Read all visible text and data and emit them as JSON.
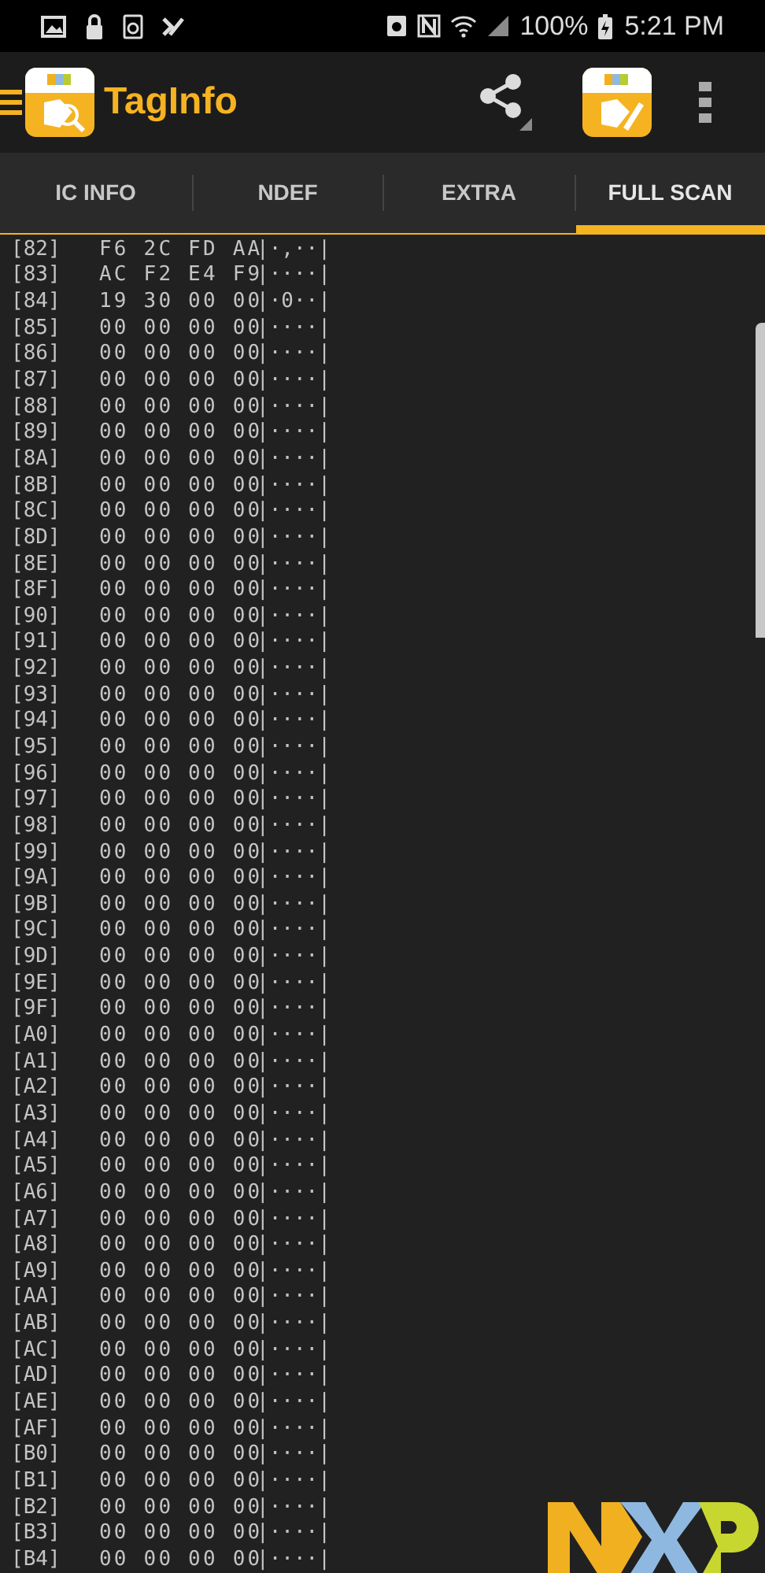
{
  "status_bar": {
    "battery": "100%",
    "time": "5:21 PM"
  },
  "app_bar": {
    "title": "TagInfo"
  },
  "tabs": [
    {
      "label": "IC INFO",
      "selected": false
    },
    {
      "label": "NDEF",
      "selected": false
    },
    {
      "label": "EXTRA",
      "selected": false
    },
    {
      "label": "FULL SCAN",
      "selected": true
    }
  ],
  "memory_rows": [
    {
      "address": "[82]",
      "bytes": "F6 2C FD AA",
      "ascii": "|·,··|"
    },
    {
      "address": "[83]",
      "bytes": "AC F2 E4 F9",
      "ascii": "|····|"
    },
    {
      "address": "[84]",
      "bytes": "19 30 00 00",
      "ascii": "|·0··|"
    },
    {
      "address": "[85]",
      "bytes": "00 00 00 00",
      "ascii": "|····|"
    },
    {
      "address": "[86]",
      "bytes": "00 00 00 00",
      "ascii": "|····|"
    },
    {
      "address": "[87]",
      "bytes": "00 00 00 00",
      "ascii": "|····|"
    },
    {
      "address": "[88]",
      "bytes": "00 00 00 00",
      "ascii": "|····|"
    },
    {
      "address": "[89]",
      "bytes": "00 00 00 00",
      "ascii": "|····|"
    },
    {
      "address": "[8A]",
      "bytes": "00 00 00 00",
      "ascii": "|····|"
    },
    {
      "address": "[8B]",
      "bytes": "00 00 00 00",
      "ascii": "|····|"
    },
    {
      "address": "[8C]",
      "bytes": "00 00 00 00",
      "ascii": "|····|"
    },
    {
      "address": "[8D]",
      "bytes": "00 00 00 00",
      "ascii": "|····|"
    },
    {
      "address": "[8E]",
      "bytes": "00 00 00 00",
      "ascii": "|····|"
    },
    {
      "address": "[8F]",
      "bytes": "00 00 00 00",
      "ascii": "|····|"
    },
    {
      "address": "[90]",
      "bytes": "00 00 00 00",
      "ascii": "|····|"
    },
    {
      "address": "[91]",
      "bytes": "00 00 00 00",
      "ascii": "|····|"
    },
    {
      "address": "[92]",
      "bytes": "00 00 00 00",
      "ascii": "|····|"
    },
    {
      "address": "[93]",
      "bytes": "00 00 00 00",
      "ascii": "|····|"
    },
    {
      "address": "[94]",
      "bytes": "00 00 00 00",
      "ascii": "|····|"
    },
    {
      "address": "[95]",
      "bytes": "00 00 00 00",
      "ascii": "|····|"
    },
    {
      "address": "[96]",
      "bytes": "00 00 00 00",
      "ascii": "|····|"
    },
    {
      "address": "[97]",
      "bytes": "00 00 00 00",
      "ascii": "|····|"
    },
    {
      "address": "[98]",
      "bytes": "00 00 00 00",
      "ascii": "|····|"
    },
    {
      "address": "[99]",
      "bytes": "00 00 00 00",
      "ascii": "|····|"
    },
    {
      "address": "[9A]",
      "bytes": "00 00 00 00",
      "ascii": "|····|"
    },
    {
      "address": "[9B]",
      "bytes": "00 00 00 00",
      "ascii": "|····|"
    },
    {
      "address": "[9C]",
      "bytes": "00 00 00 00",
      "ascii": "|····|"
    },
    {
      "address": "[9D]",
      "bytes": "00 00 00 00",
      "ascii": "|····|"
    },
    {
      "address": "[9E]",
      "bytes": "00 00 00 00",
      "ascii": "|····|"
    },
    {
      "address": "[9F]",
      "bytes": "00 00 00 00",
      "ascii": "|····|"
    },
    {
      "address": "[A0]",
      "bytes": "00 00 00 00",
      "ascii": "|····|"
    },
    {
      "address": "[A1]",
      "bytes": "00 00 00 00",
      "ascii": "|····|"
    },
    {
      "address": "[A2]",
      "bytes": "00 00 00 00",
      "ascii": "|····|"
    },
    {
      "address": "[A3]",
      "bytes": "00 00 00 00",
      "ascii": "|····|"
    },
    {
      "address": "[A4]",
      "bytes": "00 00 00 00",
      "ascii": "|····|"
    },
    {
      "address": "[A5]",
      "bytes": "00 00 00 00",
      "ascii": "|····|"
    },
    {
      "address": "[A6]",
      "bytes": "00 00 00 00",
      "ascii": "|····|"
    },
    {
      "address": "[A7]",
      "bytes": "00 00 00 00",
      "ascii": "|····|"
    },
    {
      "address": "[A8]",
      "bytes": "00 00 00 00",
      "ascii": "|····|"
    },
    {
      "address": "[A9]",
      "bytes": "00 00 00 00",
      "ascii": "|····|"
    },
    {
      "address": "[AA]",
      "bytes": "00 00 00 00",
      "ascii": "|····|"
    },
    {
      "address": "[AB]",
      "bytes": "00 00 00 00",
      "ascii": "|····|"
    },
    {
      "address": "[AC]",
      "bytes": "00 00 00 00",
      "ascii": "|····|"
    },
    {
      "address": "[AD]",
      "bytes": "00 00 00 00",
      "ascii": "|····|"
    },
    {
      "address": "[AE]",
      "bytes": "00 00 00 00",
      "ascii": "|····|"
    },
    {
      "address": "[AF]",
      "bytes": "00 00 00 00",
      "ascii": "|····|"
    },
    {
      "address": "[B0]",
      "bytes": "00 00 00 00",
      "ascii": "|····|"
    },
    {
      "address": "[B1]",
      "bytes": "00 00 00 00",
      "ascii": "|····|"
    },
    {
      "address": "[B2]",
      "bytes": "00 00 00 00",
      "ascii": "|····|"
    },
    {
      "address": "[B3]",
      "bytes": "00 00 00 00",
      "ascii": "|····|"
    },
    {
      "address": "[B4]",
      "bytes": "00 00 00 00",
      "ascii": "|····|"
    }
  ]
}
